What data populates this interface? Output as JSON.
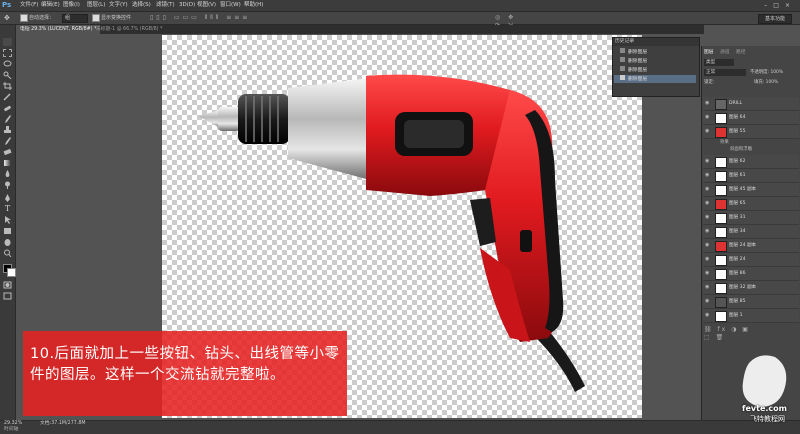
{
  "app": {
    "logo": "Ps"
  },
  "menubar": {
    "items": [
      "文件(F)",
      "编辑(E)",
      "图像(I)",
      "图层(L)",
      "文字(Y)",
      "选择(S)",
      "滤镜(T)",
      "3D(D)",
      "视图(V)",
      "窗口(W)",
      "帮助(H)"
    ],
    "window_controls": "–□×"
  },
  "options": {
    "auto_select_label": "自动选择：",
    "auto_select_value": "组",
    "show_transform": "显示变换控件",
    "workspace": "基本功能"
  },
  "tabs": [
    {
      "label": "电钻 29.3% (LUCENT, RGB/8#) *",
      "active": true
    },
    {
      "label": "未标题-1 @ 66.7% (RGB/8) *",
      "active": false
    }
  ],
  "caption": {
    "text": "10.后面就加上一些按钮、钻头、出线管等小零件的图层。这样一个交流钻就完整啦。"
  },
  "history": {
    "title": "历史记录",
    "items": [
      "删除图层",
      "删除图层",
      "删除图层",
      "删除图层"
    ]
  },
  "layers": {
    "tabs": [
      "图层",
      "通道",
      "路径"
    ],
    "filter_label": "类型",
    "blend": "正常",
    "opacity": "不透明度: 100%",
    "fill": "填充: 100%",
    "lock_label": "锁定:",
    "items": [
      {
        "name": "DRILL"
      },
      {
        "name": "图层 64"
      },
      {
        "name": "图层 55"
      },
      {
        "name": "效果"
      },
      {
        "name": "斜面和浮雕"
      },
      {
        "name": "图层 62"
      },
      {
        "name": "图层 61"
      },
      {
        "name": "图层 45 副本"
      },
      {
        "name": "图层 65"
      },
      {
        "name": "图层 31"
      },
      {
        "name": "图层 34"
      },
      {
        "name": "图层 24 副本"
      },
      {
        "name": "图层 24"
      },
      {
        "name": "图层 86"
      },
      {
        "name": "图层 32 副本"
      },
      {
        "name": "图层 85"
      },
      {
        "name": "图层 1"
      }
    ]
  },
  "status": {
    "zoom": "29.32%",
    "doc": "文档:37.1M/277.8M",
    "bottom_tab": "时间轴"
  },
  "watermark": {
    "line1": "fevte.com",
    "line2": "飞特教程网"
  },
  "colors": {
    "accent": "#e62121",
    "drill_red": "#d8141c"
  }
}
